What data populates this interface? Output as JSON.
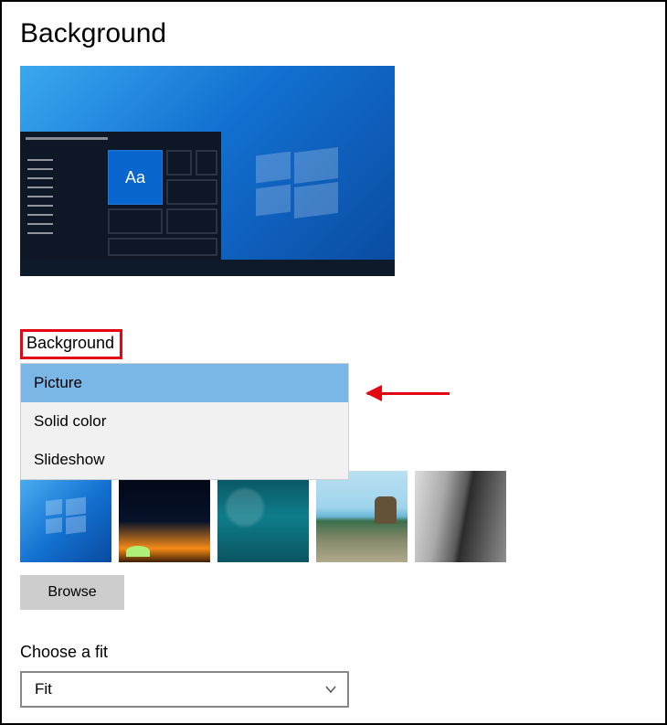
{
  "page_title": "Background",
  "preview": {
    "tile_label": "Aa"
  },
  "background_section": {
    "label": "Background",
    "options": [
      "Picture",
      "Solid color",
      "Slideshow"
    ],
    "selected": "Picture"
  },
  "thumbnails": [
    "windows-default",
    "night-horizon",
    "underwater",
    "beach-rock",
    "rock-waterfall"
  ],
  "browse_button": "Browse",
  "fit_section": {
    "label": "Choose a fit",
    "value": "Fit"
  },
  "annotation": {
    "arrow": "points-to-picture-option"
  }
}
